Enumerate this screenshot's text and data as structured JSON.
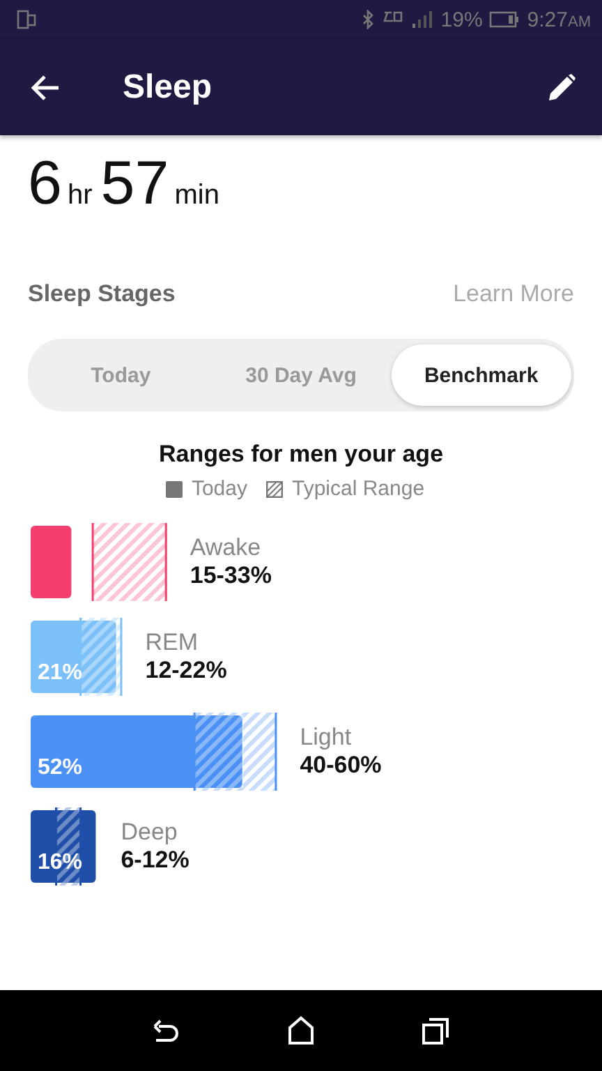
{
  "status_bar": {
    "battery": "19%",
    "time": "9:27",
    "ampm": "AM"
  },
  "app_bar": {
    "title": "Sleep"
  },
  "duration": {
    "hours": "6",
    "hours_unit": "hr",
    "minutes": "57",
    "minutes_unit": "min"
  },
  "section": {
    "title": "Sleep Stages",
    "link": "Learn More"
  },
  "tabs": [
    {
      "label": "Today",
      "selected": false
    },
    {
      "label": "30 Day Avg",
      "selected": false
    },
    {
      "label": "Benchmark",
      "selected": true
    }
  ],
  "benchmark": {
    "title": "Ranges for men your age",
    "legend": [
      {
        "kind": "solid",
        "label": "Today"
      },
      {
        "kind": "hatched",
        "label": "Typical Range"
      }
    ]
  },
  "stages": [
    {
      "name": "Awake",
      "range": "15-33%",
      "level": 0.1,
      "color": "#f43f6e"
    },
    {
      "name": "REM",
      "range": "12-22%",
      "value": "21%",
      "level": 0.21,
      "color": "#7cc0f9"
    },
    {
      "name": "Light",
      "range": "40-60%",
      "value": "52%",
      "level": 0.52,
      "color": "#4a90f5"
    },
    {
      "name": "Deep",
      "range": "6-12%",
      "value": "16%",
      "level": 0.16,
      "color": "#1f4fa8"
    }
  ]
}
